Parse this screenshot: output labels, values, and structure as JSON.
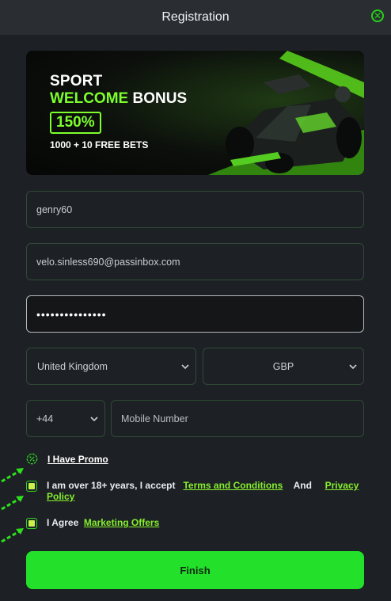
{
  "header": {
    "title": "Registration",
    "close_icon": "close-icon"
  },
  "banner": {
    "line1": "SPORT",
    "line2_green": "WELCOME",
    "line2_white": "BONUS",
    "percent": "150%",
    "bets": "1000 + 10 FREE BETS"
  },
  "form": {
    "username": "genry60",
    "email": "velo.sinless690@passinbox.com",
    "password_mask": "•••••••••••••••",
    "country": "United Kingdom",
    "currency": "GBP",
    "phone_code": "+44",
    "mobile_placeholder": "Mobile Number"
  },
  "promo": {
    "label": "I Have Promo"
  },
  "age_check": {
    "text": "I am over 18+ years, I accept",
    "terms": "Terms and Conditions",
    "and": "And",
    "privacy_line1": "Privacy",
    "privacy_line2": "Policy",
    "checked": true
  },
  "marketing": {
    "text": "I Agree",
    "link": "Marketing Offers",
    "checked": true
  },
  "finish_label": "Finish",
  "colors": {
    "accent": "#23e02a",
    "link": "#86ef2c",
    "background": "#1d2125"
  }
}
